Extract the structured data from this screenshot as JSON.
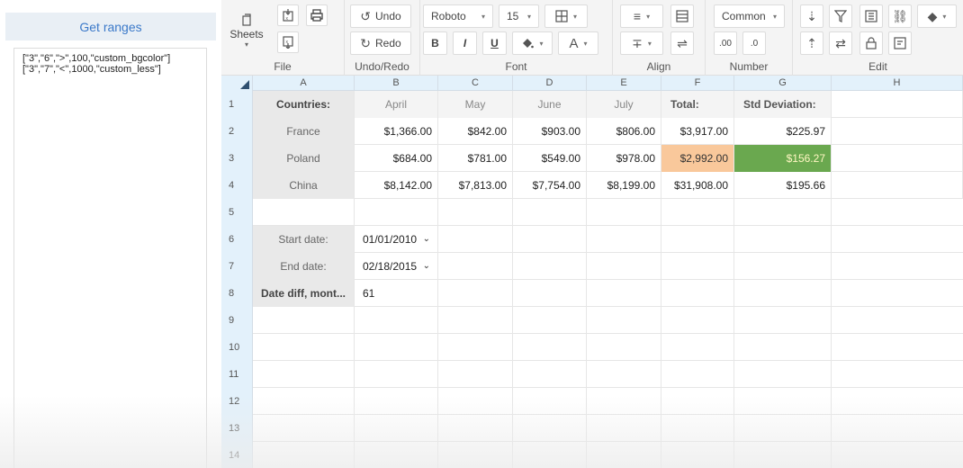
{
  "left_panel": {
    "get_ranges_label": "Get ranges",
    "ranges_lines": [
      "[\"3\",\"6\",\">\",100,\"custom_bgcolor\"]",
      "[\"3\",\"7\",\"<\",1000,\"custom_less\"]"
    ]
  },
  "toolbar": {
    "groups": {
      "file": "File",
      "undo_redo": "Undo/Redo",
      "font": "Font",
      "align": "Align",
      "number": "Number",
      "edit": "Edit"
    },
    "sheets_label": "Sheets",
    "undo_label": "Undo",
    "redo_label": "Redo",
    "font_name": "Roboto",
    "font_size": "15",
    "bold_label": "B",
    "italic_label": "I",
    "underline_label": "U",
    "number_format": "Common"
  },
  "grid": {
    "columns": [
      "A",
      "B",
      "C",
      "D",
      "E",
      "F",
      "G",
      "H"
    ],
    "row_numbers": [
      "1",
      "2",
      "3",
      "4",
      "5",
      "6",
      "7",
      "8",
      "9",
      "10",
      "11",
      "12",
      "13",
      "14"
    ],
    "header_row": {
      "a": "Countries:",
      "b": "April",
      "c": "May",
      "d": "June",
      "e": "July",
      "f": "Total:",
      "g": "Std Deviation:"
    },
    "data_rows": [
      {
        "a": "France",
        "b": "$1,366.00",
        "c": "$842.00",
        "d": "$903.00",
        "e": "$806.00",
        "f": "$3,917.00",
        "g": "$225.97"
      },
      {
        "a": "Poland",
        "b": "$684.00",
        "c": "$781.00",
        "d": "$549.00",
        "e": "$978.00",
        "f": "$2,992.00",
        "g": "$156.27"
      },
      {
        "a": "China",
        "b": "$8,142.00",
        "c": "$7,813.00",
        "d": "$7,754.00",
        "e": "$8,199.00",
        "f": "$31,908.00",
        "g": "$195.66"
      }
    ],
    "start_date_label": "Start date:",
    "start_date_value": "01/01/2010",
    "end_date_label": "End date:",
    "end_date_value": "02/18/2015",
    "date_diff_label": "Date diff, mont...",
    "date_diff_value": "61",
    "highlight_colors": {
      "orange": "#f9c89b",
      "green": "#6aa84f"
    }
  }
}
